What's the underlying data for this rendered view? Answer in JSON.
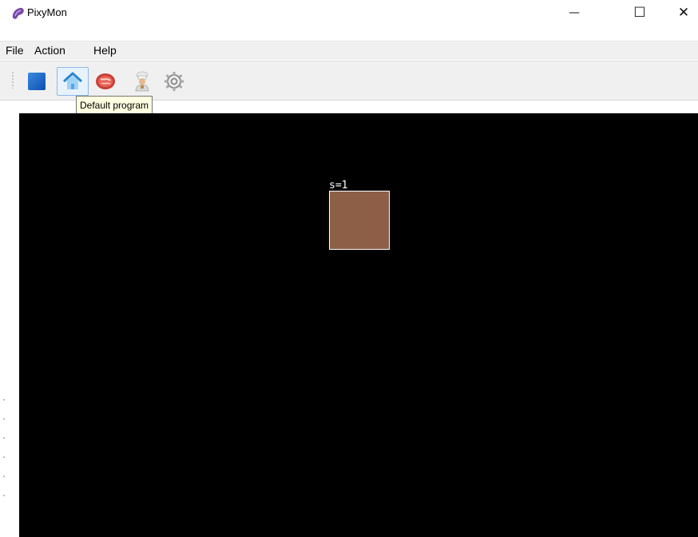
{
  "window": {
    "title": "PixyMon",
    "controls": {
      "minimize": "—",
      "maximize": "☐",
      "close": "✕"
    }
  },
  "menu": {
    "items": [
      "File",
      "Action",
      "Help"
    ]
  },
  "toolbar": {
    "buttons": [
      {
        "icon": "blue-square-icon"
      },
      {
        "icon": "home-icon"
      },
      {
        "icon": "steak-icon"
      },
      {
        "icon": "chef-icon"
      },
      {
        "icon": "gear-icon"
      }
    ],
    "tooltip": "Default program"
  },
  "video": {
    "block_label": "s=1",
    "block_color": "#8e5f47",
    "background": "#000000"
  }
}
